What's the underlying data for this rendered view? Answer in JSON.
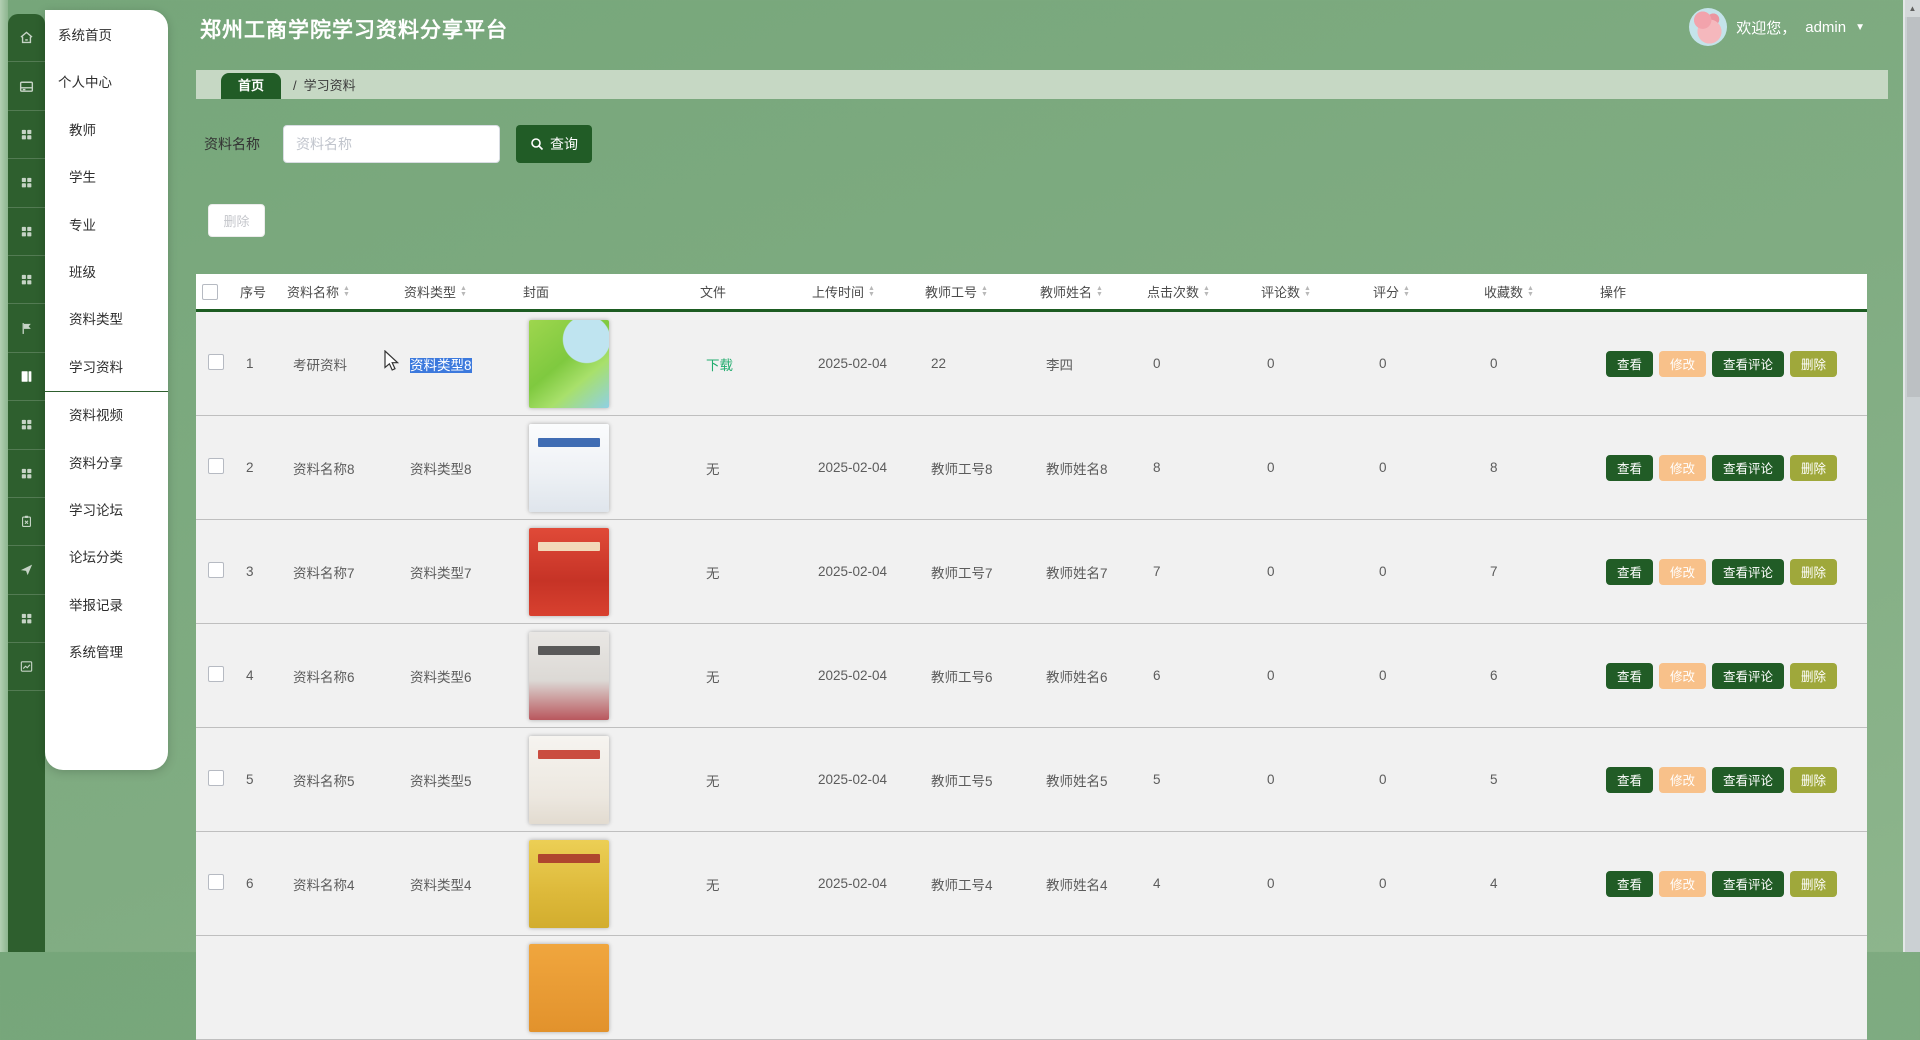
{
  "app": {
    "title": "郑州工商学院学习资料分享平台"
  },
  "user": {
    "welcome": "欢迎您，",
    "name": "admin",
    "caret": "▼"
  },
  "sidebar": {
    "items": [
      {
        "key": "system-home",
        "label": "系统首页",
        "icon": "home",
        "active": false,
        "sub": false
      },
      {
        "key": "personal-center",
        "label": "个人中心",
        "icon": "card",
        "active": false,
        "sub": false
      },
      {
        "key": "teacher",
        "label": "教师",
        "icon": "grid",
        "active": false,
        "sub": true
      },
      {
        "key": "student",
        "label": "学生",
        "icon": "grid",
        "active": false,
        "sub": true
      },
      {
        "key": "major",
        "label": "专业",
        "icon": "grid",
        "active": false,
        "sub": true
      },
      {
        "key": "class",
        "label": "班级",
        "icon": "grid",
        "active": false,
        "sub": true
      },
      {
        "key": "material-type",
        "label": "资料类型",
        "icon": "flag",
        "active": false,
        "sub": true
      },
      {
        "key": "study-material",
        "label": "学习资料",
        "icon": "book",
        "active": true,
        "sub": true
      },
      {
        "key": "material-video",
        "label": "资料视频",
        "icon": "grid",
        "active": false,
        "sub": true
      },
      {
        "key": "material-share",
        "label": "资料分享",
        "icon": "grid",
        "active": false,
        "sub": true
      },
      {
        "key": "study-forum",
        "label": "学习论坛",
        "icon": "clipboard",
        "active": false,
        "sub": true
      },
      {
        "key": "forum-category",
        "label": "论坛分类",
        "icon": "send",
        "active": false,
        "sub": true
      },
      {
        "key": "report-record",
        "label": "举报记录",
        "icon": "grid",
        "active": false,
        "sub": true
      },
      {
        "key": "system-manage",
        "label": "系统管理",
        "icon": "chart",
        "active": false,
        "sub": true
      }
    ]
  },
  "breadcrumb": {
    "home": "首页",
    "sep": "/",
    "current": "学习资料"
  },
  "search": {
    "label": "资料名称",
    "placeholder": "资料名称",
    "button": "查询"
  },
  "toolbar": {
    "delete": "删除"
  },
  "table": {
    "columns": [
      {
        "label": "序号",
        "sortable": false
      },
      {
        "label": "资料名称",
        "sortable": true
      },
      {
        "label": "资料类型",
        "sortable": true
      },
      {
        "label": "封面",
        "sortable": false
      },
      {
        "label": "文件",
        "sortable": false
      },
      {
        "label": "上传时间",
        "sortable": true
      },
      {
        "label": "教师工号",
        "sortable": true
      },
      {
        "label": "教师姓名",
        "sortable": true
      },
      {
        "label": "点击次数",
        "sortable": true
      },
      {
        "label": "评论数",
        "sortable": true
      },
      {
        "label": "评分",
        "sortable": true
      },
      {
        "label": "收藏数",
        "sortable": true
      },
      {
        "label": "操作",
        "sortable": false
      }
    ],
    "actions": [
      "查看",
      "修改",
      "查看评论",
      "删除"
    ],
    "rows": [
      {
        "seq": "1",
        "name": "考研资料",
        "type": "资料类型8",
        "type_selected": true,
        "file": "下载",
        "file_link": true,
        "date": "2025-02-04",
        "teacher_id": "22",
        "teacher_name": "李四",
        "clicks": "0",
        "comments": "0",
        "rating": "0",
        "favorites": "0",
        "cover": {
          "bg": "radial-gradient(circle at 72% 22%, #bfe4f0 0 26%, rgba(0,0,0,0) 27%), linear-gradient(140deg,#9ed64e 0%,#7fc93f 45%,#a8e06b 68%,#8fd0e4 100%)",
          "bar": ""
        },
        "partial": false
      },
      {
        "seq": "2",
        "name": "资料名称8",
        "type": "资料类型8",
        "type_selected": false,
        "file": "无",
        "file_link": false,
        "date": "2025-02-04",
        "teacher_id": "教师工号8",
        "teacher_name": "教师姓名8",
        "clicks": "8",
        "comments": "0",
        "rating": "0",
        "favorites": "8",
        "cover": {
          "bg": "linear-gradient(180deg,#fbfcfd 0%,#eef1f5 55%,#dfe5ec 100%)",
          "bar": "#2b5cab"
        },
        "partial": false
      },
      {
        "seq": "3",
        "name": "资料名称7",
        "type": "资料类型7",
        "type_selected": false,
        "file": "无",
        "file_link": false,
        "date": "2025-02-04",
        "teacher_id": "教师工号7",
        "teacher_name": "教师姓名7",
        "clicks": "7",
        "comments": "0",
        "rating": "0",
        "favorites": "7",
        "cover": {
          "bg": "linear-gradient(180deg,#e04a38 0%,#c63326 60%,#d8412f 100%)",
          "bar": "#f5e9c8"
        },
        "partial": false
      },
      {
        "seq": "4",
        "name": "资料名称6",
        "type": "资料类型6",
        "type_selected": false,
        "file": "无",
        "file_link": false,
        "date": "2025-02-04",
        "teacher_id": "教师工号6",
        "teacher_name": "教师姓名6",
        "clicks": "6",
        "comments": "0",
        "rating": "0",
        "favorites": "6",
        "cover": {
          "bg": "linear-gradient(180deg,#e9e7e4 0%,#dcd9d5 55%,#b9575d 100%)",
          "bar": "#4a4a4a"
        },
        "partial": false
      },
      {
        "seq": "5",
        "name": "资料名称5",
        "type": "资料类型5",
        "type_selected": false,
        "file": "无",
        "file_link": false,
        "date": "2025-02-04",
        "teacher_id": "教师工号5",
        "teacher_name": "教师姓名5",
        "clicks": "5",
        "comments": "0",
        "rating": "0",
        "favorites": "5",
        "cover": {
          "bg": "linear-gradient(180deg,#f6f4f0 0%,#ece7df 70%,#e2dbd0 100%)",
          "bar": "#c53b2e"
        },
        "partial": false
      },
      {
        "seq": "6",
        "name": "资料名称4",
        "type": "资料类型4",
        "type_selected": false,
        "file": "无",
        "file_link": false,
        "date": "2025-02-04",
        "teacher_id": "教师工号4",
        "teacher_name": "教师姓名4",
        "clicks": "4",
        "comments": "0",
        "rating": "0",
        "favorites": "4",
        "cover": {
          "bg": "linear-gradient(180deg,#eccf55 0%,#ddb93a 60%,#d2ad2e 100%)",
          "bar": "#a8372b"
        },
        "partial": false
      },
      {
        "seq": "",
        "name": "",
        "type": "",
        "type_selected": false,
        "file": "",
        "file_link": false,
        "date": "",
        "teacher_id": "",
        "teacher_name": "",
        "clicks": "",
        "comments": "",
        "rating": "",
        "favorites": "",
        "cover": {
          "bg": "linear-gradient(180deg,#f0a63e,#e2922c)",
          "bar": ""
        },
        "partial": true
      }
    ]
  },
  "colors": {
    "accent_green": "#215c26",
    "sidebar_green": "#2e5f2e",
    "edit_peach": "#f8c18a",
    "delete_olive": "#9fa83b",
    "download_green": "#23ad6f",
    "selection_blue": "#3c79dd",
    "breadcrumb_bg": "#c6d8c4"
  }
}
